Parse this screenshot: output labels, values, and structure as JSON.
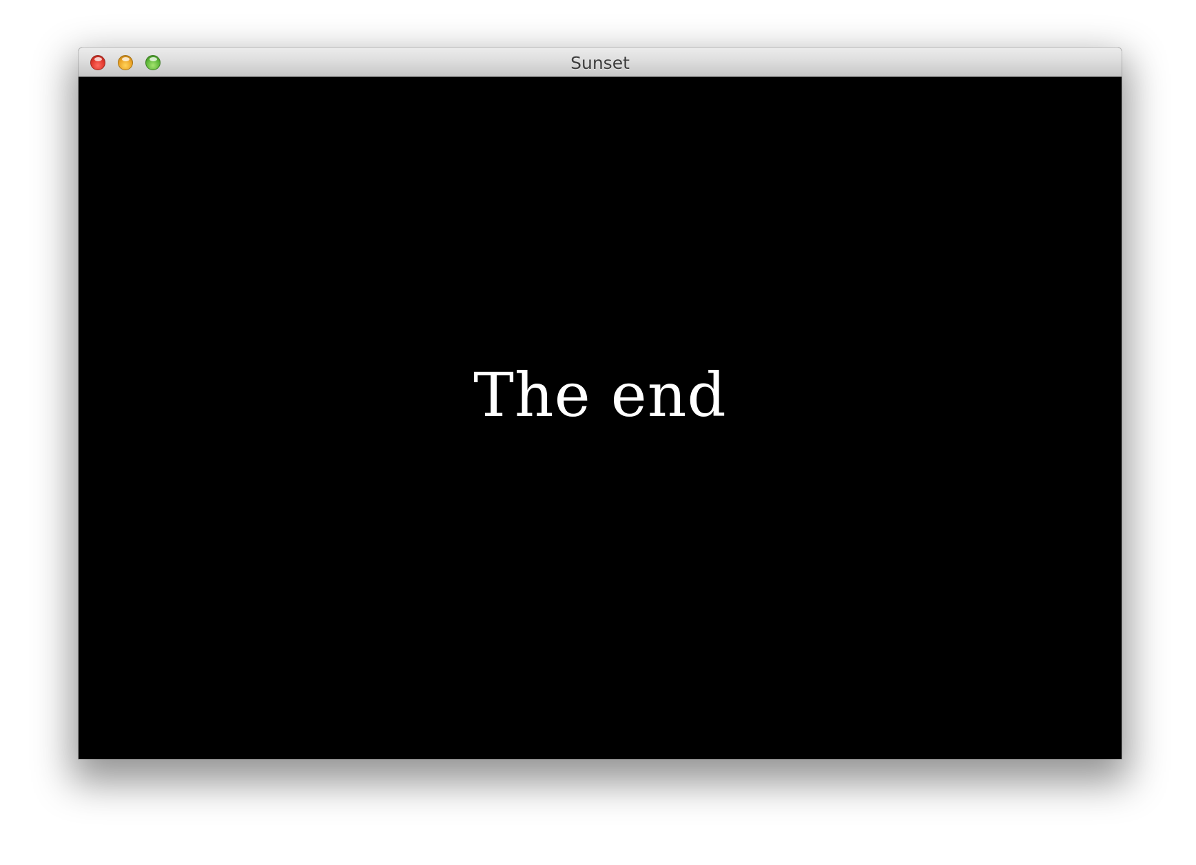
{
  "window": {
    "title": "Sunset",
    "controls": {
      "close": "close-button",
      "minimize": "minimize-button",
      "maximize": "zoom-button"
    }
  },
  "content": {
    "message": "The end",
    "background_color": "#000000",
    "text_color": "#ffffff"
  }
}
